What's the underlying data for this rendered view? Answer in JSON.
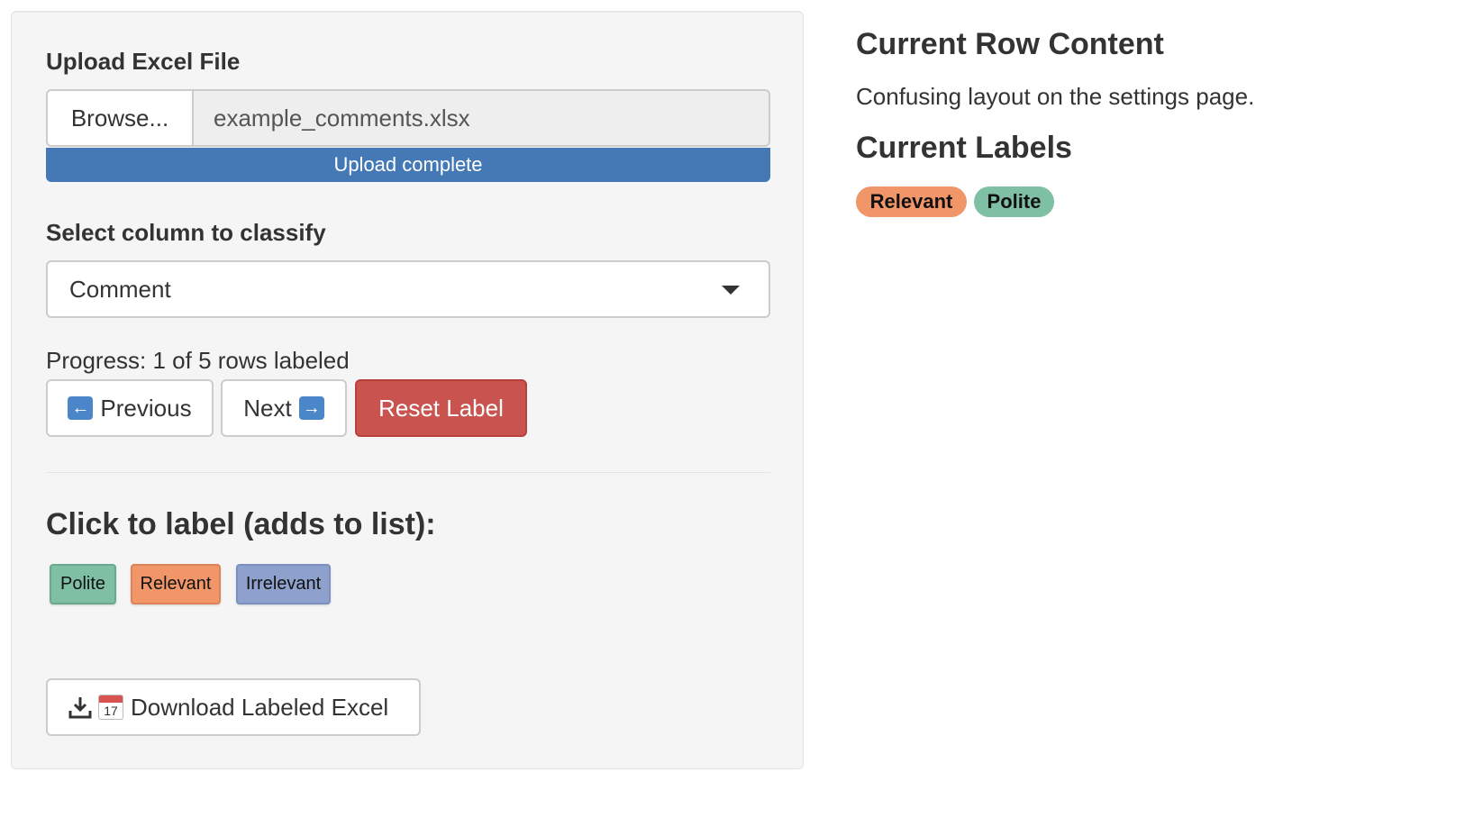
{
  "sidebar": {
    "upload": {
      "label": "Upload Excel File",
      "browse_label": "Browse...",
      "file_name": "example_comments.xlsx",
      "progress_text": "Upload complete",
      "progress_value": 1.0
    },
    "column_select": {
      "label": "Select column to classify",
      "selected": "Comment"
    },
    "progress": {
      "text": "Progress: 1 of 5 rows labeled"
    },
    "nav_buttons": {
      "previous_label": "Previous",
      "next_label": "Next",
      "reset_label": "Reset Label"
    },
    "labeling": {
      "heading": "Click to label (adds to list):",
      "tags": [
        {
          "label": "Polite",
          "color": "#7fbfa4"
        },
        {
          "label": "Relevant",
          "color": "#f19668"
        },
        {
          "label": "Irrelevant",
          "color": "#8ea0cc"
        }
      ]
    },
    "download": {
      "label": "Download Labeled Excel",
      "calendar_day": "17",
      "icons": [
        "download-icon",
        "calendar-icon"
      ]
    }
  },
  "main": {
    "row_title": "Current Row Content",
    "row_content": "Confusing layout on the settings page.",
    "labels_title": "Current Labels",
    "current_labels": [
      {
        "label": "Relevant",
        "color": "#f19668"
      },
      {
        "label": "Polite",
        "color": "#7fbfa4"
      }
    ]
  },
  "colors": {
    "progress_bar": "#4479b6",
    "reset_button": "#c9534f",
    "panel_background": "#f5f5f5"
  }
}
